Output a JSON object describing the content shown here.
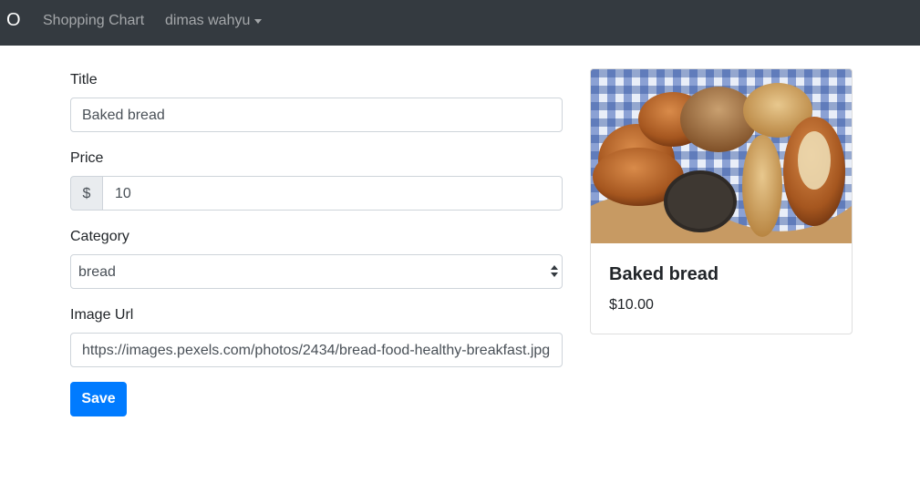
{
  "navbar": {
    "brand": "O",
    "link_shopping": "Shopping Chart",
    "user_menu": "dimas wahyu"
  },
  "form": {
    "title_label": "Title",
    "title_value": "Baked bread",
    "price_label": "Price",
    "price_prefix": "$",
    "price_value": "10",
    "category_label": "Category",
    "category_value": "bread",
    "image_url_label": "Image Url",
    "image_url_value": "https://images.pexels.com/photos/2434/bread-food-healthy-breakfast.jpg",
    "save_label": "Save"
  },
  "preview": {
    "title": "Baked bread",
    "price": "$10.00",
    "image_subject": "assorted baked bread rolls on a blue checkered cloth"
  },
  "colors": {
    "navbar_bg": "#343a40",
    "primary": "#007bff"
  }
}
